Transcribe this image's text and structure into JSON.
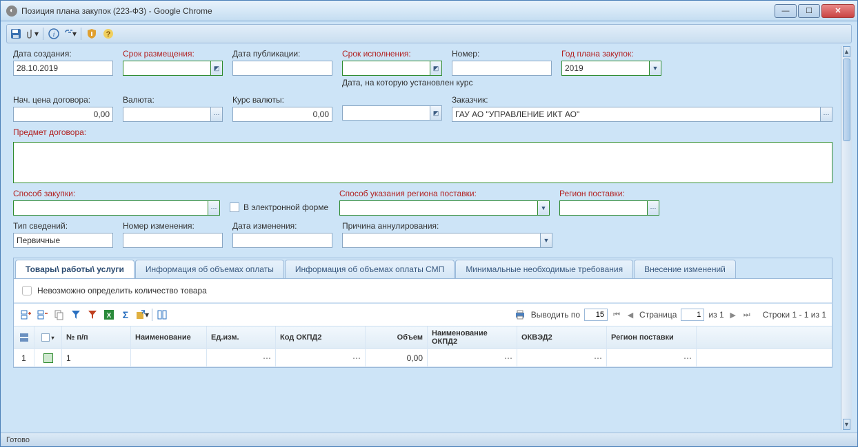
{
  "window": {
    "title": "Позиция плана закупок (223-ФЗ) - Google Chrome"
  },
  "form": {
    "created": {
      "label": "Дата создания:",
      "value": "28.10.2019"
    },
    "placement": {
      "label": "Срок размещения:",
      "value": ""
    },
    "publication": {
      "label": "Дата публикации:",
      "value": ""
    },
    "execution": {
      "label": "Срок исполнения:",
      "value": "",
      "sub": "Дата, на которую установлен курс"
    },
    "number": {
      "label": "Номер:",
      "value": ""
    },
    "plan_year": {
      "label": "Год плана закупок:",
      "value": "2019"
    },
    "start_price": {
      "label": "Нач. цена договора:",
      "value": "0,00"
    },
    "currency": {
      "label": "Валюта:",
      "value": ""
    },
    "curs": {
      "label": "Курс валюты:",
      "value": "0,00"
    },
    "customer": {
      "label": "Заказчик:",
      "value": "ГАУ АО \"УПРАВЛЕНИЕ ИКТ АО\""
    },
    "subject": {
      "label": "Предмет договора:",
      "value": ""
    },
    "method": {
      "label": "Способ закупки:",
      "value": ""
    },
    "electronic": {
      "label": "В электронной форме"
    },
    "region_method": {
      "label": "Способ указания региона поставки:",
      "value": ""
    },
    "delivery_region": {
      "label": "Регион поставки:",
      "value": ""
    },
    "info_type": {
      "label": "Тип сведений:",
      "value": "Первичные"
    },
    "change_number": {
      "label": "Номер изменения:",
      "value": ""
    },
    "change_date": {
      "label": "Дата изменения:",
      "value": ""
    },
    "cancel_reason": {
      "label": "Причина аннулирования:",
      "value": ""
    }
  },
  "tabs": {
    "t0": "Товары\\ работы\\ услуги",
    "t1": "Информация об объемах оплаты",
    "t2": "Информация об объемах оплаты СМП",
    "t3": "Минимальные необходимые требования",
    "t4": "Внесение изменений"
  },
  "tab_content": {
    "impossible_check": "Невозможно определить количество товара"
  },
  "paging": {
    "show_by": "Выводить по",
    "per_page": "15",
    "page_label": "Страница",
    "page": "1",
    "of": "из 1",
    "rows": "Строки 1 - 1 из 1"
  },
  "grid": {
    "cols": {
      "np": "№ п/п",
      "name": "Наименование",
      "unit": "Ед.изм.",
      "okpd": "Код ОКПД2",
      "volume": "Объем",
      "okpd_name": "Наименование ОКПД2",
      "okved": "ОКВЭД2",
      "region": "Регион поставки"
    },
    "rows": [
      {
        "rn": "1",
        "np": "1",
        "name": "",
        "unit": "",
        "okpd": "",
        "volume": "0,00",
        "okpd_name": "",
        "okved": "",
        "region": ""
      }
    ]
  },
  "status": {
    "text": "Готово"
  }
}
